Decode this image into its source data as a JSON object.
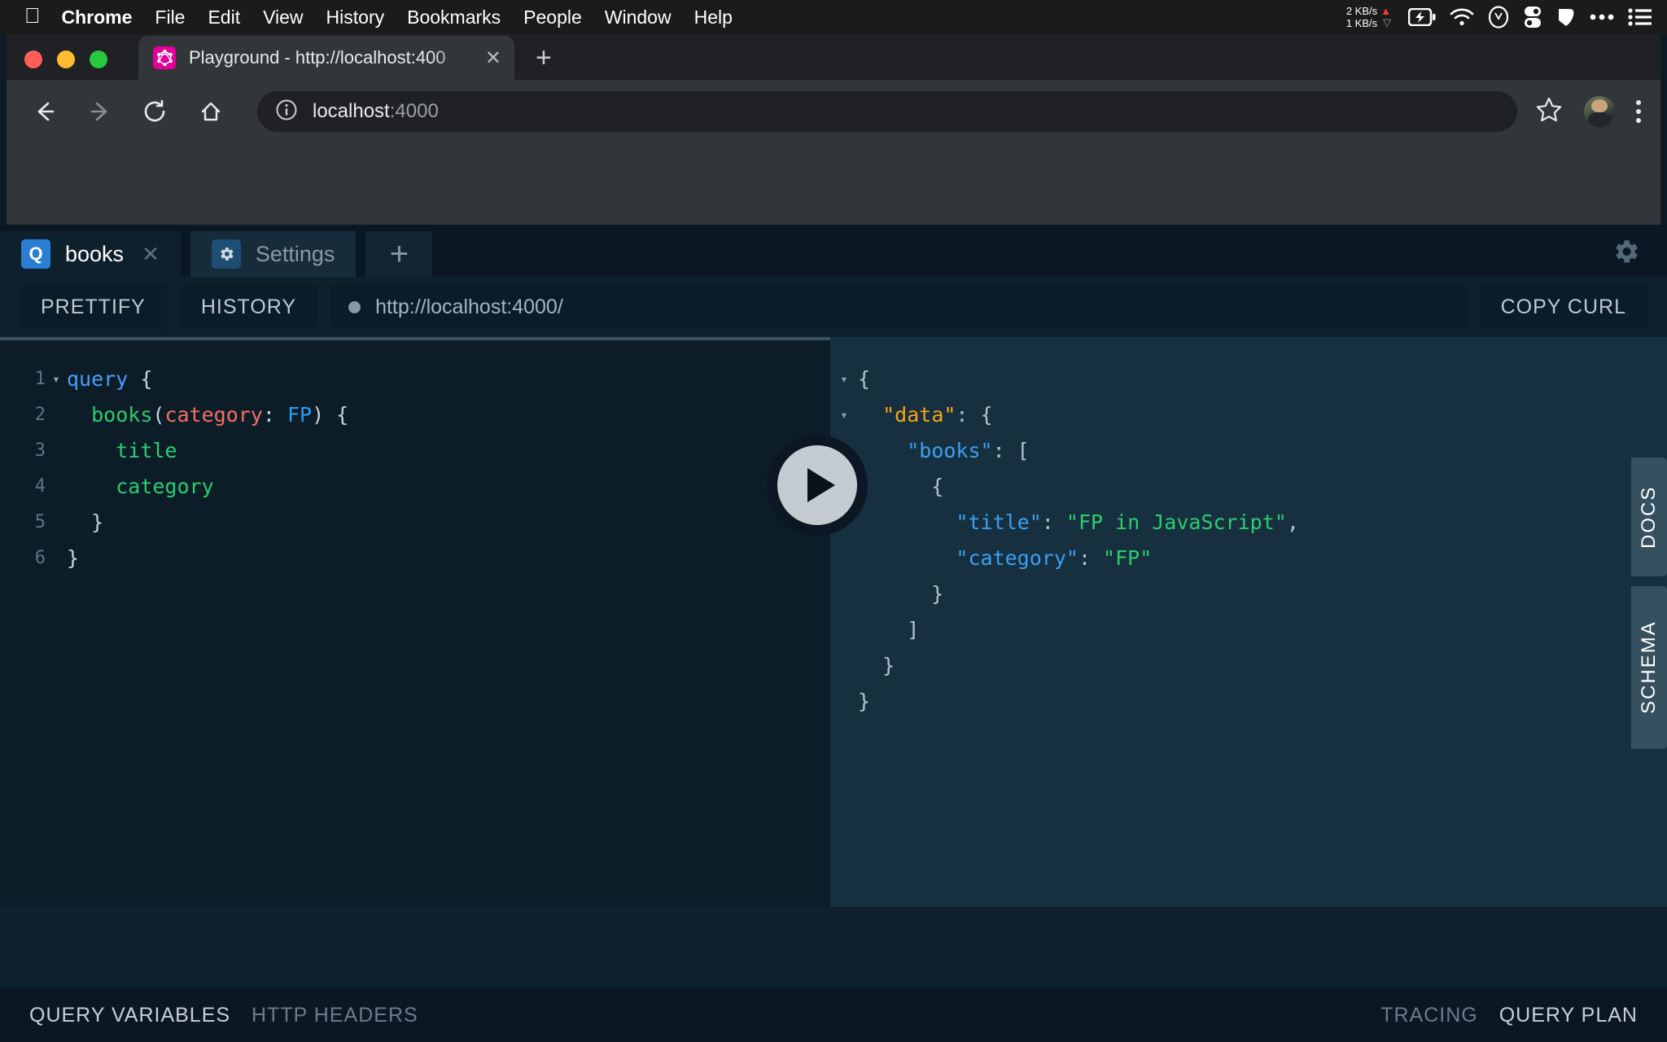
{
  "macbar": {
    "apple_icon": "apple-icon",
    "menus": [
      {
        "label": "Chrome",
        "bold": true
      },
      {
        "label": "File",
        "bold": false
      },
      {
        "label": "Edit",
        "bold": false
      },
      {
        "label": "View",
        "bold": false
      },
      {
        "label": "History",
        "bold": false
      },
      {
        "label": "Bookmarks",
        "bold": false
      },
      {
        "label": "People",
        "bold": false
      },
      {
        "label": "Window",
        "bold": false
      },
      {
        "label": "Help",
        "bold": false
      }
    ],
    "network": {
      "upload": "2 KB/s",
      "download": "1 KB/s",
      "up_arrow_color": "#ff3b30",
      "down_arrow_color": "#9a9a9a"
    },
    "status_icons": [
      "battery-charging-icon",
      "wifi-icon",
      "clock-icon",
      "toggle-icon",
      "dropbox-icon",
      "ellipsis-icon",
      "list-icon"
    ]
  },
  "browser": {
    "tab": {
      "title": "Playground - http://localhost:400",
      "favicon": "graphql-icon",
      "favicon_color": "#e10098",
      "close_icon": "close-icon"
    },
    "new_tab_icon": "plus-icon",
    "nav": {
      "back_icon": "arrow-left-icon",
      "forward_icon": "arrow-right-icon",
      "reload_icon": "reload-icon",
      "home_icon": "home-icon"
    },
    "omnibox": {
      "info_icon": "info-circle-icon",
      "host": "localhost",
      "port": ":4000"
    },
    "bookmark_icon": "star-icon",
    "profile_icon": "avatar",
    "menu_icon": "kebab-menu-icon"
  },
  "playground": {
    "tabs": [
      {
        "label": "books",
        "badge": "Q",
        "badge_type": "query",
        "active": true,
        "closable": true
      },
      {
        "label": "Settings",
        "badge": "gear-icon",
        "badge_type": "settings",
        "active": false,
        "closable": false
      }
    ],
    "add_tab_icon": "plus-icon",
    "settings_gear_icon": "gear-icon",
    "toolbar": {
      "prettify_label": "PRETTIFY",
      "history_label": "HISTORY",
      "endpoint": "http://localhost:4000/",
      "endpoint_status_dot_color": "#8a96a0",
      "copy_curl_label": "COPY CURL"
    },
    "run_button_icon": "play-icon",
    "editor": {
      "lines": [
        {
          "num": "1",
          "fold": "▾",
          "segments": [
            {
              "t": "query",
              "c": "gq-kw"
            },
            {
              "t": " {",
              "c": "gq-punct"
            }
          ]
        },
        {
          "num": "2",
          "fold": "",
          "segments": [
            {
              "t": "  ",
              "c": "gq-punct"
            },
            {
              "t": "books",
              "c": "gq-field"
            },
            {
              "t": "(",
              "c": "gq-punct"
            },
            {
              "t": "category",
              "c": "gq-arg"
            },
            {
              "t": ": ",
              "c": "gq-punct"
            },
            {
              "t": "FP",
              "c": "gq-val"
            },
            {
              "t": ") {",
              "c": "gq-punct"
            }
          ]
        },
        {
          "num": "3",
          "fold": "",
          "segments": [
            {
              "t": "    ",
              "c": "gq-punct"
            },
            {
              "t": "title",
              "c": "gq-field"
            }
          ]
        },
        {
          "num": "4",
          "fold": "",
          "segments": [
            {
              "t": "    ",
              "c": "gq-punct"
            },
            {
              "t": "category",
              "c": "gq-field"
            }
          ]
        },
        {
          "num": "5",
          "fold": "",
          "segments": [
            {
              "t": "  }",
              "c": "gq-punct"
            }
          ]
        },
        {
          "num": "6",
          "fold": "",
          "segments": [
            {
              "t": "}",
              "c": "gq-punct"
            }
          ]
        }
      ]
    },
    "response": {
      "lines": [
        {
          "fold": "▾",
          "segments": [
            {
              "t": "{",
              "c": "js-punct"
            }
          ]
        },
        {
          "fold": "▾",
          "segments": [
            {
              "t": "  ",
              "c": "js-punct"
            },
            {
              "t": "\"data\"",
              "c": "js-key-data"
            },
            {
              "t": ": {",
              "c": "js-punct"
            }
          ]
        },
        {
          "fold": "▾",
          "segments": [
            {
              "t": "    ",
              "c": "js-punct"
            },
            {
              "t": "\"books\"",
              "c": "js-key"
            },
            {
              "t": ": [",
              "c": "js-punct"
            }
          ]
        },
        {
          "fold": "",
          "segments": [
            {
              "t": "      {",
              "c": "js-punct"
            }
          ]
        },
        {
          "fold": "",
          "segments": [
            {
              "t": "        ",
              "c": "js-punct"
            },
            {
              "t": "\"title\"",
              "c": "js-key"
            },
            {
              "t": ": ",
              "c": "js-punct"
            },
            {
              "t": "\"FP in JavaScript\"",
              "c": "js-str"
            },
            {
              "t": ",",
              "c": "js-punct"
            }
          ]
        },
        {
          "fold": "",
          "segments": [
            {
              "t": "        ",
              "c": "js-punct"
            },
            {
              "t": "\"category\"",
              "c": "js-key"
            },
            {
              "t": ": ",
              "c": "js-punct"
            },
            {
              "t": "\"FP\"",
              "c": "js-str"
            }
          ]
        },
        {
          "fold": "",
          "segments": [
            {
              "t": "      }",
              "c": "js-punct"
            }
          ]
        },
        {
          "fold": "",
          "segments": [
            {
              "t": "    ]",
              "c": "js-punct"
            }
          ]
        },
        {
          "fold": "",
          "segments": [
            {
              "t": "  }",
              "c": "js-punct"
            }
          ]
        },
        {
          "fold": "",
          "segments": [
            {
              "t": "}",
              "c": "js-punct"
            }
          ]
        }
      ],
      "parsed": {
        "data": {
          "books": [
            {
              "title": "FP in JavaScript",
              "category": "FP"
            }
          ]
        }
      }
    },
    "side_tabs": [
      {
        "label": "DOCS"
      },
      {
        "label": "SCHEMA"
      }
    ],
    "footer": {
      "left": [
        {
          "label": "QUERY VARIABLES",
          "active": true
        },
        {
          "label": "HTTP HEADERS",
          "active": false
        }
      ],
      "right": [
        {
          "label": "TRACING",
          "active": false
        },
        {
          "label": "QUERY PLAN",
          "active": true
        }
      ]
    }
  },
  "colors": {
    "playground_bg": "#0f202d",
    "editor_bg": "#0d1d28",
    "result_bg": "#16303f",
    "accent_blue": "#2a7ed3",
    "graphql_pink": "#e10098"
  }
}
